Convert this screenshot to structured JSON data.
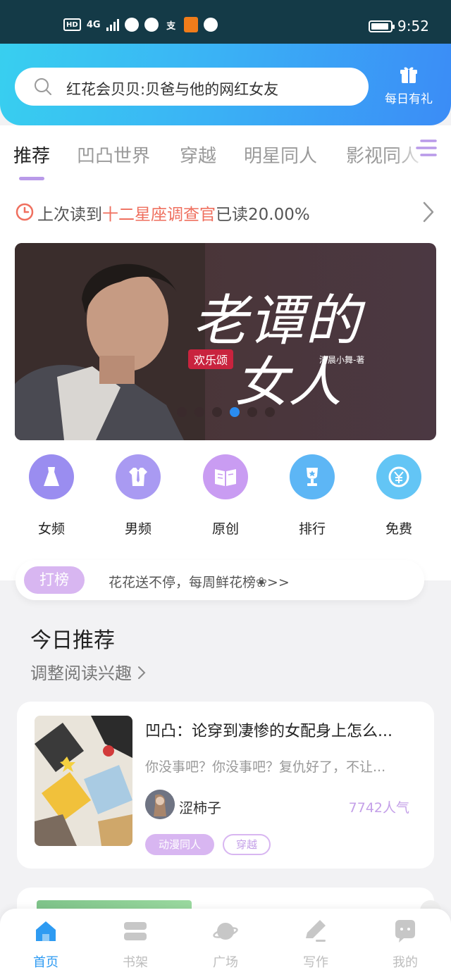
{
  "status_bar": {
    "network_hd": "HD",
    "network_type": "4G",
    "alipay": "支",
    "time": "9:52"
  },
  "header": {
    "search_placeholder": "红花会贝贝:贝爸与他的网红女友",
    "gift_label": "每日有礼",
    "gift_icon": "gift-icon"
  },
  "tabs": [
    {
      "label": "推荐",
      "active": true
    },
    {
      "label": "凹凸世界",
      "active": false
    },
    {
      "label": "穿越",
      "active": false
    },
    {
      "label": "明星同人",
      "active": false
    },
    {
      "label": "影视同人",
      "active": false
    }
  ],
  "last_read": {
    "prefix": "上次读到",
    "book": "十二星座调查官",
    "suffix": "已读20.00%"
  },
  "banner": {
    "title_line1": "老谭的",
    "title_line2": "女人",
    "tag": "欢乐颂",
    "author": "清晨小舞-著",
    "dots_total": 6,
    "active_dot": 4
  },
  "categories": [
    {
      "label": "女频",
      "icon": "dress-icon",
      "color": "#9a8df0"
    },
    {
      "label": "男频",
      "icon": "shirt-icon",
      "color": "#a99af2"
    },
    {
      "label": "原创",
      "icon": "book-icon",
      "color": "#c99cf2"
    },
    {
      "label": "排行",
      "icon": "trophy-icon",
      "color": "#5db6f5"
    },
    {
      "label": "免费",
      "icon": "yuan-icon",
      "color": "#63c5f5"
    }
  ],
  "rank": {
    "badge": "打榜",
    "text": "花花送不停，每周鲜花榜❀>>"
  },
  "today": {
    "title": "今日推荐",
    "adjust": "调整阅读兴趣"
  },
  "book": {
    "title": "凹凸：论穿到凄惨的女配身上怎么...",
    "desc": "你没事吧？你没事吧？复仇好了，不让...",
    "author": "涩柿子",
    "popularity": "7742人气",
    "tags": [
      "动漫同人",
      "穿越"
    ]
  },
  "bottom_nav": [
    {
      "label": "首页",
      "icon": "home-icon",
      "active": true
    },
    {
      "label": "书架",
      "icon": "bookshelf-icon",
      "active": false
    },
    {
      "label": "广场",
      "icon": "planet-icon",
      "active": false
    },
    {
      "label": "写作",
      "icon": "pen-icon",
      "active": false
    },
    {
      "label": "我的",
      "icon": "chat-icon",
      "active": false
    }
  ],
  "colors": {
    "accent_purple": "#c4a0e8",
    "header_blue": "#3ab4f5",
    "active_blue": "#2e9bf2",
    "highlight_red": "#ef6f5e"
  }
}
